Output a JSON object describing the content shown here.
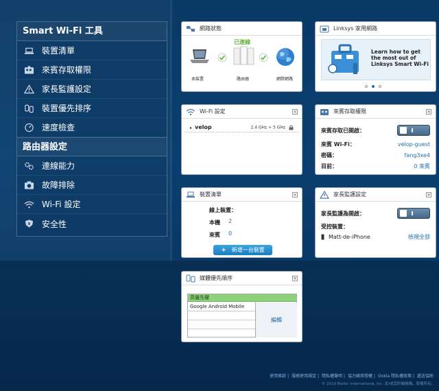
{
  "sidebar": {
    "tools_title": "Smart Wi-Fi 工具",
    "tools": [
      {
        "label": "裝置清單",
        "icon": "laptop-icon"
      },
      {
        "label": "來賓存取權限",
        "icon": "guest-icon"
      },
      {
        "label": "家長監護設定",
        "icon": "warning-icon"
      },
      {
        "label": "裝置優先排序",
        "icon": "priority-icon"
      },
      {
        "label": "速度檢查",
        "icon": "speedometer-icon"
      }
    ],
    "router_title": "路由器設定",
    "router": [
      {
        "label": "連線能力",
        "icon": "gears-icon"
      },
      {
        "label": "故障排除",
        "icon": "camera-icon"
      },
      {
        "label": "Wi-Fi 設定",
        "icon": "wifi-icon"
      },
      {
        "label": "安全性",
        "icon": "shield-icon"
      }
    ]
  },
  "network": {
    "title": "網路狀態",
    "status": "已連線",
    "device": "本裝置",
    "router": "路由器",
    "internet": "網際網路"
  },
  "linksys": {
    "title": "Linksys 家用網路",
    "promo": "Learn how to get the most out of Linksys Smart Wi-Fi"
  },
  "wifi": {
    "title": "Wi-Fi 設定",
    "ssid": "velop",
    "band": "2.4 GHz + 5 GHz"
  },
  "guest": {
    "title": "來賓存取權限",
    "enabled_label": "來賓存取已開啟：",
    "wifi_label": "來賓 Wi-Fi：",
    "wifi_value": "velop-guest",
    "password_label": "密碼：",
    "password_value": "fang3xe4",
    "current_label": "目前：",
    "current_value": "0 來賓"
  },
  "devices": {
    "title": "裝置清單",
    "online_label": "線上裝置：",
    "this_label": "本機",
    "this_value": "2",
    "guest_label": "來賓",
    "guest_value": "0",
    "add_button": "新增一台裝置"
  },
  "parental": {
    "title": "家長監護設定",
    "enabled_label": "家長監護為開啟：",
    "restricted_label": "受控裝置：",
    "device": "Matt-de-iPhone",
    "view_all": "檢視全部"
  },
  "media": {
    "title": "媒體優先順序",
    "high_priority": "高優先權",
    "device": "Google Android Mobile",
    "edit": "編輯"
  },
  "footer": {
    "links": [
      "使用條款",
      "服務使用規定",
      "隱私權聲明",
      "協力廠商授權",
      "Ookla 隱私權政策",
      "遞送協助"
    ],
    "copyright": "© 2019 Belkin International, Inc. 及/或其附屬機構。版權所有。"
  },
  "colors": {
    "accent": "#1e6ea8",
    "check": "#6cc04a",
    "status": "#5cb33a",
    "priority_bg": "#8fd17a"
  }
}
